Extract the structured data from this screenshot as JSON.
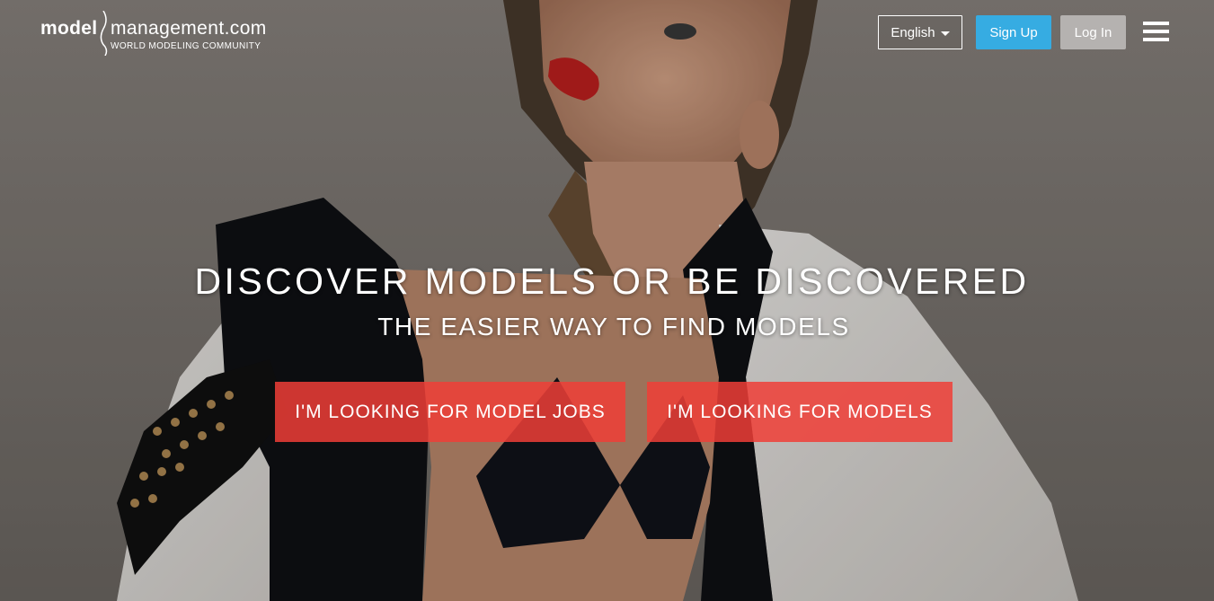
{
  "header": {
    "logo_model": "model",
    "logo_management": "management.com",
    "logo_tagline": "WORLD MODELING COMMUNITY",
    "language_label": "English",
    "signup_label": "Sign Up",
    "login_label": "Log In",
    "menu_icon": "hamburger-menu-icon"
  },
  "hero": {
    "headline": "DISCOVER MODELS OR BE DISCOVERED",
    "subhead": "THE EASIER WAY TO FIND MODELS",
    "cta_jobs_label": "I'M LOOKING FOR MODEL JOBS",
    "cta_models_label": "I'M LOOKING FOR MODELS"
  },
  "colors": {
    "signup": "#36ace2",
    "login": "#b5b2b0",
    "cta": "#f03e37"
  }
}
